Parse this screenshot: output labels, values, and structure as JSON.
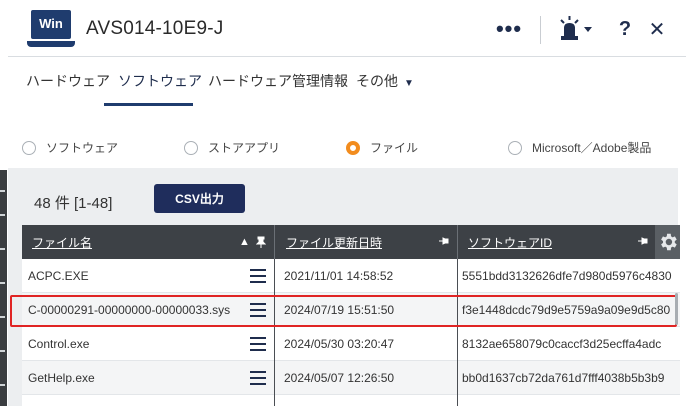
{
  "header": {
    "os_badge": "Win",
    "device_name": "AVS014-10E9-J",
    "more_label": "•••",
    "help_label": "?",
    "close_label": "✕"
  },
  "tabs": [
    {
      "label": "ハードウェア"
    },
    {
      "label": "ソフトウェア",
      "active": true
    },
    {
      "label": "ハードウェア管理情報"
    },
    {
      "label": "その他"
    }
  ],
  "radios": [
    {
      "label": "ソフトウェア",
      "selected": false
    },
    {
      "label": "ストアアプリ",
      "selected": false
    },
    {
      "label": "ファイル",
      "selected": true
    },
    {
      "label": "Microsoft／Adobe製品",
      "selected": false
    }
  ],
  "results": {
    "count_text": "48 件  [1-48]",
    "csv_button": "CSV出力"
  },
  "table": {
    "columns": [
      "ファイル名",
      "ファイル更新日時",
      "ソフトウェアID"
    ],
    "rows": [
      {
        "name": "ACPC.EXE",
        "updated": "2021/11/01 14:58:52",
        "software_id": "5551bdd3132626dfe7d980d5976c4830"
      },
      {
        "name": "C-00000291-00000000-00000033.sys",
        "updated": "2024/07/19 15:51:50",
        "software_id": "f3e1448dcdc79d9e5759a9a09e9d5c80"
      },
      {
        "name": "Control.exe",
        "updated": "2024/05/30 03:20:47",
        "software_id": "8132ae658079c0caccf3d25ecffa4adc"
      },
      {
        "name": "GetHelp.exe",
        "updated": "2024/05/07 12:26:50",
        "software_id": "bb0d1637cb72da761d7fff4038b5b3b9"
      }
    ],
    "highlighted_row": 1
  },
  "colors": {
    "brand": "#1f3c6e",
    "radio_selected": "#f28c1e",
    "highlight": "#e02424"
  }
}
